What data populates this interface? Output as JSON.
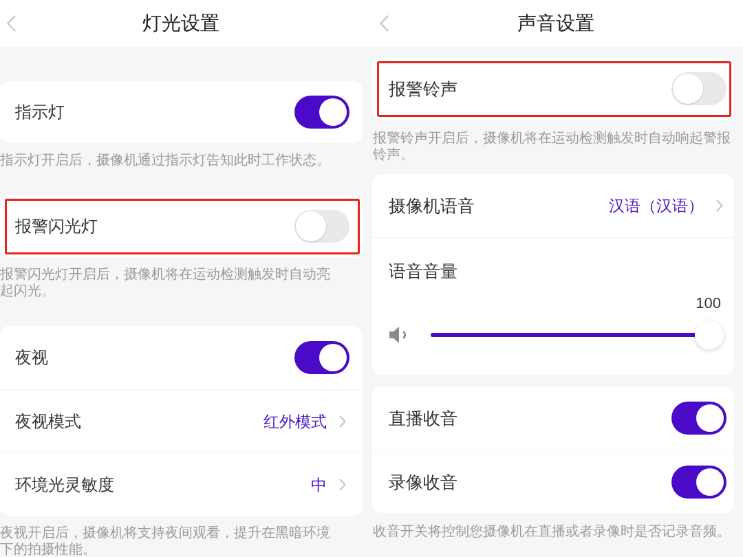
{
  "panels": [
    {
      "title": "灯光设置",
      "sections": [
        {
          "rows": [
            {
              "kind": "toggle",
              "label": "指示灯",
              "on": true,
              "highlighted": false
            }
          ],
          "note": "指示灯开启后，摄像机通过指示灯告知此时工作状态。"
        },
        {
          "rows": [
            {
              "kind": "toggle",
              "label": "报警闪光灯",
              "on": false,
              "highlighted": true
            }
          ],
          "note": "报警闪光灯开启后，摄像机将在运动检测触发时自动亮起闪光。"
        },
        {
          "rows": [
            {
              "kind": "toggle",
              "label": "夜视",
              "on": true,
              "highlighted": false
            },
            {
              "kind": "select",
              "label": "夜视模式",
              "value": "红外模式",
              "highlighted": false
            },
            {
              "kind": "select",
              "label": "环境光灵敏度",
              "value": "中",
              "highlighted": false
            }
          ],
          "note": "夜视开启后，摄像机将支持夜间观看，提升在黑暗环境下的拍摄性能。"
        }
      ]
    },
    {
      "title": "声音设置",
      "sections": [
        {
          "rows": [
            {
              "kind": "toggle",
              "label": "报警铃声",
              "on": false,
              "highlighted": true
            }
          ],
          "note": "报警铃声开启后，摄像机将在运动检测触发时自动响起警报铃声。"
        },
        {
          "rows": [
            {
              "kind": "select",
              "label": "摄像机语音",
              "value": "汉语（汉语）",
              "highlighted": false
            },
            {
              "kind": "slider",
              "label": "语音音量",
              "reading": "100",
              "level": 1,
              "highlighted": false
            }
          ]
        },
        {
          "rows": [
            {
              "kind": "toggle",
              "label": "直播收音",
              "on": true,
              "highlighted": false
            },
            {
              "kind": "toggle",
              "label": "录像收音",
              "on": true,
              "highlighted": false
            }
          ],
          "note": "收音开关将控制您摄像机在直播或者录像时是否记录音频。"
        }
      ]
    }
  ]
}
